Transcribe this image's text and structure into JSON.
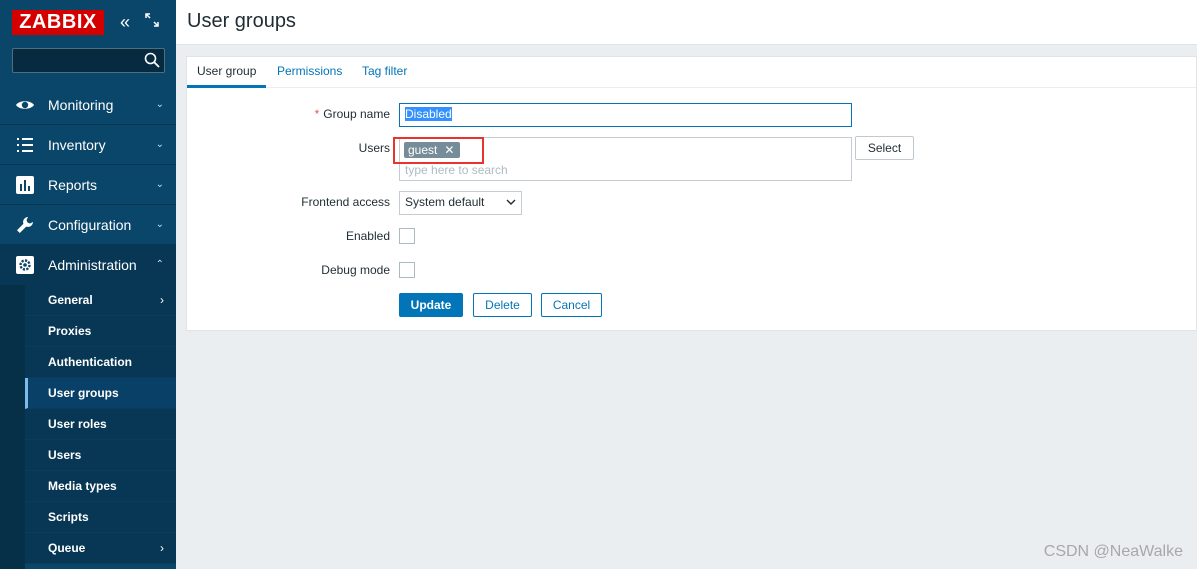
{
  "sidebar": {
    "logo": "ZABBIX",
    "collapse_icon": "double-chevron-left",
    "kiosk_icon": "expand-corners",
    "search": {
      "value": "",
      "placeholder": ""
    },
    "menu": [
      {
        "label": "Monitoring",
        "icon": "eye-icon",
        "arrow": "⌄"
      },
      {
        "label": "Inventory",
        "icon": "list-icon",
        "arrow": "⌄"
      },
      {
        "label": "Reports",
        "icon": "bar-chart-icon",
        "arrow": "⌄"
      },
      {
        "label": "Configuration",
        "icon": "wrench-icon",
        "arrow": "⌄"
      },
      {
        "label": "Administration",
        "icon": "gear-icon",
        "arrow": "⌃"
      }
    ],
    "submenu": [
      {
        "label": "General",
        "arrow": "›"
      },
      {
        "label": "Proxies"
      },
      {
        "label": "Authentication"
      },
      {
        "label": "User groups"
      },
      {
        "label": "User roles"
      },
      {
        "label": "Users"
      },
      {
        "label": "Media types"
      },
      {
        "label": "Scripts"
      },
      {
        "label": "Queue",
        "arrow": "›"
      }
    ]
  },
  "header": {
    "title": "User groups"
  },
  "tabs": [
    "User group",
    "Permissions",
    "Tag filter"
  ],
  "form": {
    "group_name": {
      "required_mark": "*",
      "label": "Group name",
      "value": "Disabled"
    },
    "users": {
      "label": "Users",
      "chip": "guest",
      "chip_remove": "✕",
      "placeholder": "type here to search",
      "select_button": "Select"
    },
    "frontend_access": {
      "label": "Frontend access",
      "value": "System default"
    },
    "enabled": {
      "label": "Enabled",
      "checked": false
    },
    "debug_mode": {
      "label": "Debug mode",
      "checked": false
    },
    "buttons": {
      "update": "Update",
      "delete": "Delete",
      "cancel": "Cancel"
    }
  },
  "watermark": "CSDN @NeaWalke",
  "colors": {
    "sidebar": "#0a466a",
    "accent": "#0275b8",
    "logo": "#d40000",
    "highlight": "#e8332f"
  }
}
